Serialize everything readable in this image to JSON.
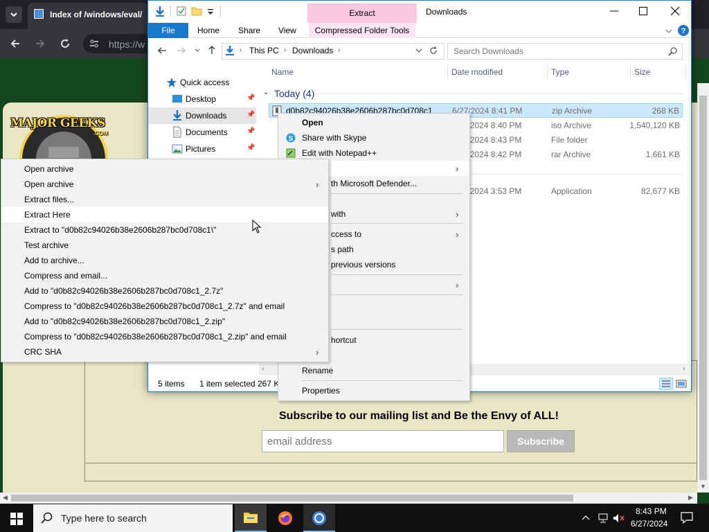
{
  "browser": {
    "tab_title": "Index of /windows/eval/",
    "address": "https://w"
  },
  "page": {
    "logo_text": "MAJOR GEEKS",
    "logo_com": ".COM",
    "subscribe_heading": "Subscribe to our mailing list and Be the Envy of ALL!",
    "email_placeholder": "email address",
    "subscribe_button": "Subscribe"
  },
  "explorer": {
    "title": "Downloads",
    "extract_tab": "Extract",
    "ribbon_tabs": [
      "File",
      "Home",
      "Share",
      "View",
      "Compressed Folder Tools"
    ],
    "breadcrumb": [
      "This PC",
      "Downloads"
    ],
    "search_placeholder": "Search Downloads",
    "columns": [
      "Name",
      "Date modified",
      "Type",
      "Size"
    ],
    "nav": {
      "quick_access": "Quick access",
      "items": [
        "Desktop",
        "Downloads",
        "Documents",
        "Pictures"
      ]
    },
    "group_label": "Today (4)",
    "files": [
      {
        "name": "d0b82c94026b38e2606b287bc0d708c1",
        "date": "6/27/2024 8:41 PM",
        "type": "zip Archive",
        "size": "268 KB"
      },
      {
        "name": "",
        "date": "6/27/2024 8:40 PM",
        "type": "iso Archive",
        "size": "1,540,120 KB"
      },
      {
        "name": "",
        "date": "6/27/2024 8:43 PM",
        "type": "File folder",
        "size": ""
      },
      {
        "name": "",
        "date": "6/27/2024 8:42 PM",
        "type": "rar Archive",
        "size": "1,661 KB"
      },
      {
        "name": "",
        "date": "6/27/2024 3:53 PM",
        "type": "Application",
        "size": "82,677 KB"
      }
    ],
    "status_items": "5 items",
    "status_selected": "1 item selected",
    "status_size": "267 K"
  },
  "context_menu": {
    "open": "Open",
    "share_skype": "Share with Skype",
    "edit_notepad": "Edit with Notepad++",
    "defender_partial": "th Microsoft Defender...",
    "open_with_partial": "with",
    "give_access_partial": "ccess to",
    "copy_path_partial": "s path",
    "prev_versions_partial": "previous versions",
    "shortcut_partial": "hortcut",
    "rename": "Rename",
    "properties": "Properties"
  },
  "sevenzip_menu": [
    "Open archive",
    "Open archive",
    "Extract files...",
    "Extract Here",
    "Extract to \"d0b82c94026b38e2606b287bc0d708c1\\\"",
    "Test archive",
    "Add to archive...",
    "Compress and email...",
    "Add to \"d0b82c94026b38e2606b287bc0d708c1_2.7z\"",
    "Compress to \"d0b82c94026b38e2606b287bc0d708c1_2.7z\" and email",
    "Add to \"d0b82c94026b38e2606b287bc0d708c1_2.zip\"",
    "Compress to \"d0b82c94026b38e2606b287bc0d708c1_2.zip\" and email",
    "CRC SHA"
  ],
  "taskbar": {
    "search_text": "Type here to search",
    "time": "8:43 PM",
    "date": "6/27/2024"
  },
  "colors": {
    "accent": "#1979ca",
    "selection": "#cce8ff",
    "extract_pink": "#f7c8de",
    "page_green": "#14461c"
  }
}
